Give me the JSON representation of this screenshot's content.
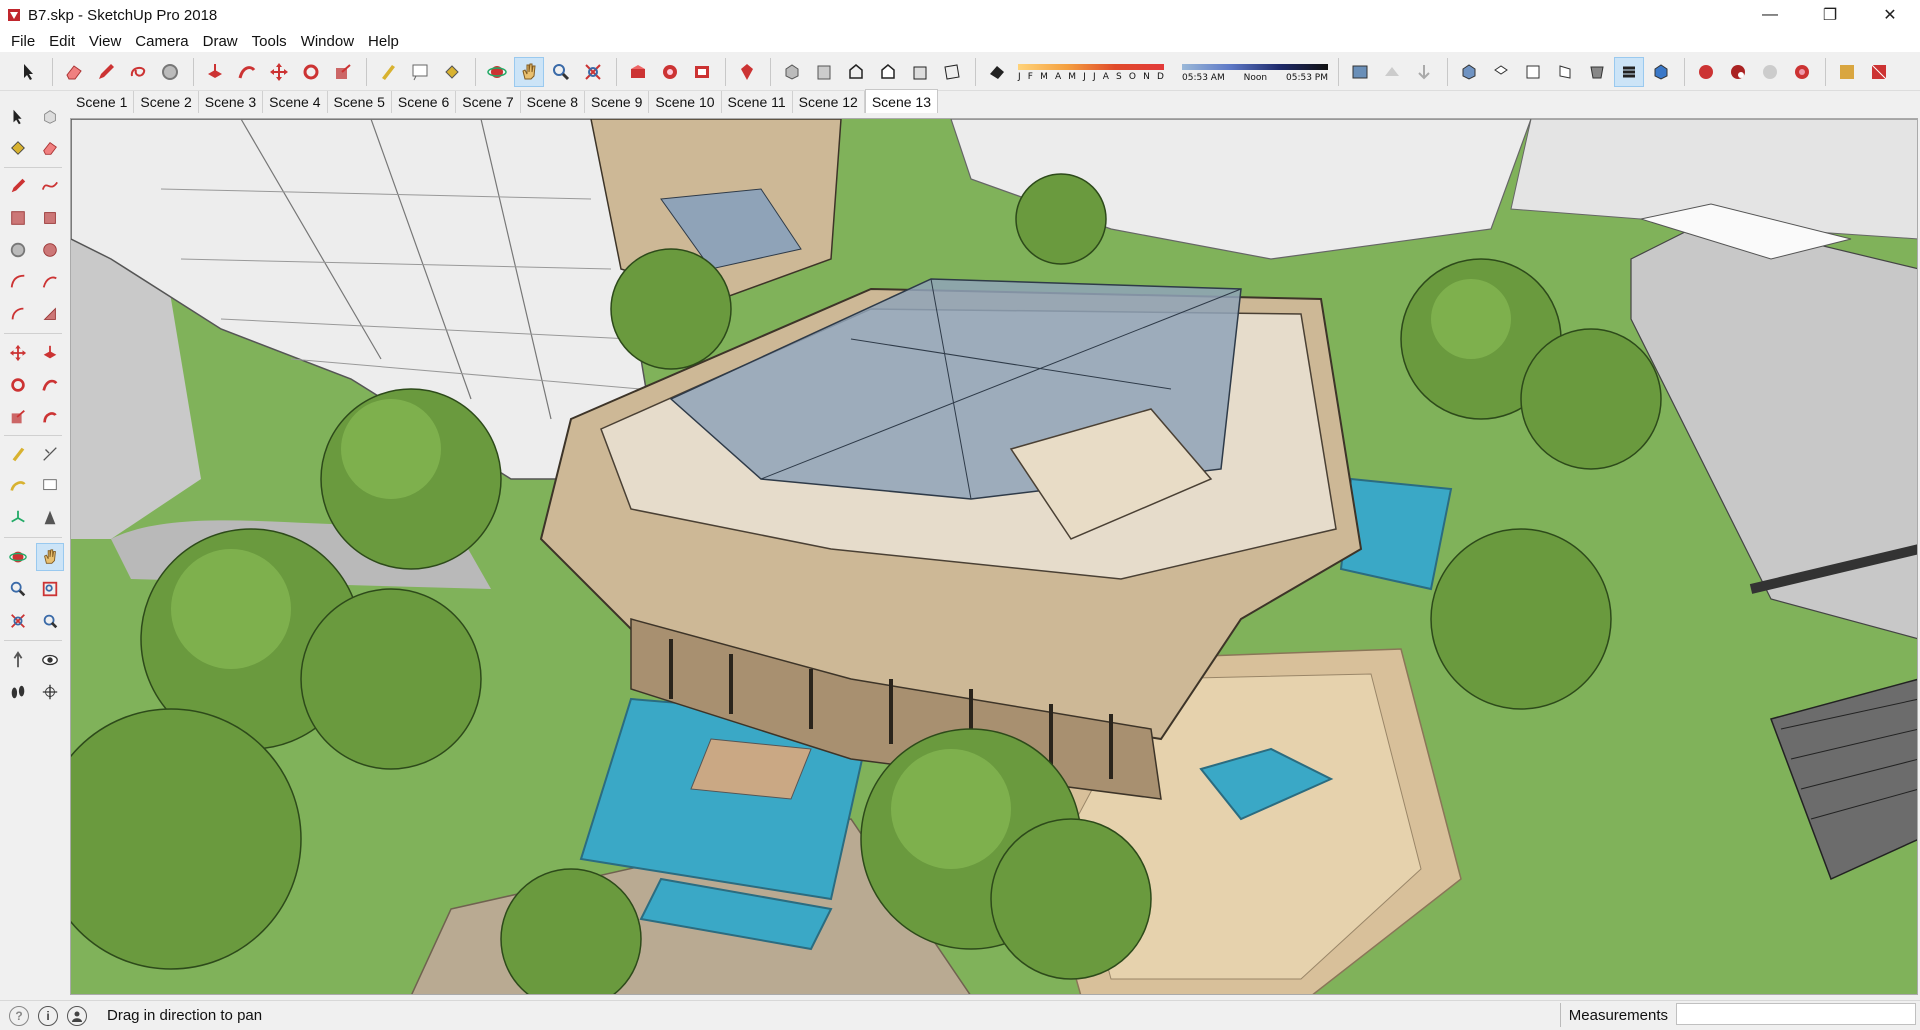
{
  "window": {
    "title": "B7.skp - SketchUp Pro 2018",
    "minimize_glyph": "—",
    "restore_glyph": "❐",
    "close_glyph": "✕"
  },
  "menu": [
    "File",
    "Edit",
    "View",
    "Camera",
    "Draw",
    "Tools",
    "Window",
    "Help"
  ],
  "toolbar": {
    "icons": [
      "select-icon",
      "eraser-icon",
      "pencil-icon",
      "lasso-icon",
      "circle-icon",
      "push-pull-icon",
      "follow-me-icon",
      "move-icon",
      "rotate-icon",
      "scale-icon",
      "tape-measure-icon",
      "text-icon",
      "paint-bucket-icon",
      "orbit-icon",
      "pan-icon",
      "zoom-icon",
      "zoom-extents-icon",
      "warehouse-icon",
      "extension-warehouse-icon",
      "components-icon",
      "ruby-icon",
      "xray-icon",
      "back-edges-icon",
      "wireframe-icon",
      "hidden-line-icon",
      "shaded-icon",
      "textured-icon",
      "monochrome-icon"
    ],
    "shadow_months": [
      "J",
      "F",
      "M",
      "A",
      "M",
      "J",
      "J",
      "A",
      "S",
      "O",
      "N",
      "D"
    ],
    "shadow_time_start": "05:53 AM",
    "shadow_time_mid": "Noon",
    "shadow_time_end": "05:53 PM"
  },
  "scenes": [
    "Scene 1",
    "Scene 2",
    "Scene 3",
    "Scene 4",
    "Scene 5",
    "Scene 6",
    "Scene 7",
    "Scene 8",
    "Scene 9",
    "Scene 10",
    "Scene 11",
    "Scene 12",
    "Scene 13"
  ],
  "active_scene": "Scene 13",
  "status": {
    "message": "Drag in direction to pan",
    "info_glyph": "i",
    "measurements_label": "Measurements",
    "measurements_value": ""
  },
  "colors": {
    "grass": "#7fb35a",
    "roof": "#e6dccb",
    "glass": "#8fa3b8",
    "water": "#3aa8c6",
    "tree": "#6a9a3e",
    "building_white": "#e9e9e9",
    "accent_red": "#c0262d"
  }
}
